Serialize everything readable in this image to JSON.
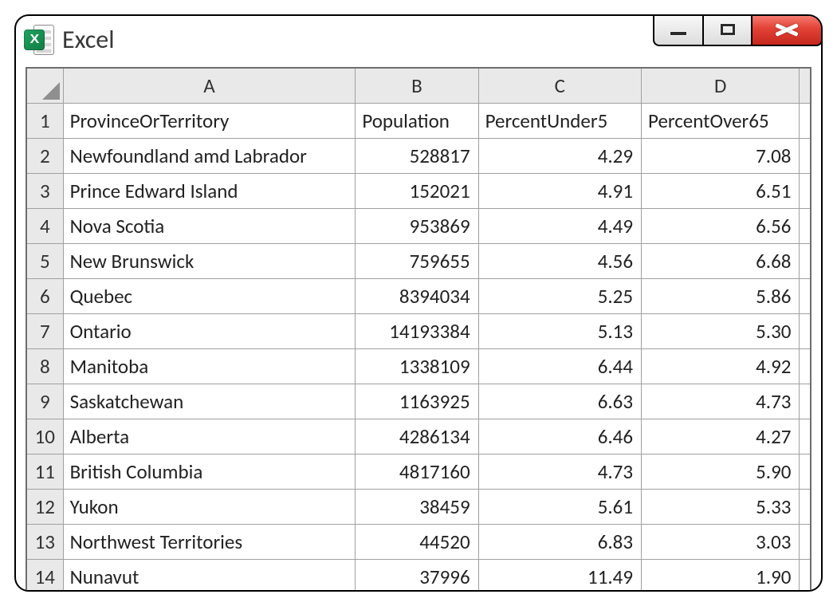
{
  "app": {
    "title": "Excel",
    "icon_letter": "X"
  },
  "columns": [
    "A",
    "B",
    "C",
    "D"
  ],
  "header_row": {
    "A": "ProvinceOrTerritory",
    "B": "Population",
    "C": "PercentUnder5",
    "D": "PercentOver65"
  },
  "rows": [
    {
      "n": "1"
    },
    {
      "n": "2",
      "A": "Newfoundland amd Labrador",
      "B": "528817",
      "C": "4.29",
      "D": "7.08"
    },
    {
      "n": "3",
      "A": "Prince Edward Island",
      "B": "152021",
      "C": "4.91",
      "D": "6.51"
    },
    {
      "n": "4",
      "A": "Nova Scotia",
      "B": "953869",
      "C": "4.49",
      "D": "6.56"
    },
    {
      "n": "5",
      "A": "New Brunswick",
      "B": "759655",
      "C": "4.56",
      "D": "6.68"
    },
    {
      "n": "6",
      "A": "Quebec",
      "B": "8394034",
      "C": "5.25",
      "D": "5.86"
    },
    {
      "n": "7",
      "A": "Ontario",
      "B": "14193384",
      "C": "5.13",
      "D": "5.30"
    },
    {
      "n": "8",
      "A": "Manitoba",
      "B": "1338109",
      "C": "6.44",
      "D": "4.92"
    },
    {
      "n": "9",
      "A": "Saskatchewan",
      "B": "1163925",
      "C": "6.63",
      "D": "4.73"
    },
    {
      "n": "10",
      "A": "Alberta",
      "B": "4286134",
      "C": "6.46",
      "D": "4.27"
    },
    {
      "n": "11",
      "A": "British Columbia",
      "B": "4817160",
      "C": "4.73",
      "D": "5.90"
    },
    {
      "n": "12",
      "A": "Yukon",
      "B": "38459",
      "C": "5.61",
      "D": "5.33"
    },
    {
      "n": "13",
      "A": "Northwest Territories",
      "B": "44520",
      "C": "6.83",
      "D": "3.03"
    },
    {
      "n": "14",
      "A": "Nunavut",
      "B": "37996",
      "C": "11.49",
      "D": "1.90"
    }
  ],
  "chart_data": {
    "type": "table",
    "columns": [
      "ProvinceOrTerritory",
      "Population",
      "PercentUnder5",
      "PercentOver65"
    ],
    "records": [
      [
        "Newfoundland amd Labrador",
        528817,
        4.29,
        7.08
      ],
      [
        "Prince Edward Island",
        152021,
        4.91,
        6.51
      ],
      [
        "Nova Scotia",
        953869,
        4.49,
        6.56
      ],
      [
        "New Brunswick",
        759655,
        4.56,
        6.68
      ],
      [
        "Quebec",
        8394034,
        5.25,
        5.86
      ],
      [
        "Ontario",
        14193384,
        5.13,
        5.3
      ],
      [
        "Manitoba",
        1338109,
        6.44,
        4.92
      ],
      [
        "Saskatchewan",
        1163925,
        6.63,
        4.73
      ],
      [
        "Alberta",
        4286134,
        6.46,
        4.27
      ],
      [
        "British Columbia",
        4817160,
        4.73,
        5.9
      ],
      [
        "Yukon",
        38459,
        5.61,
        5.33
      ],
      [
        "Northwest Territories",
        44520,
        6.83,
        3.03
      ],
      [
        "Nunavut",
        37996,
        11.49,
        1.9
      ]
    ]
  }
}
